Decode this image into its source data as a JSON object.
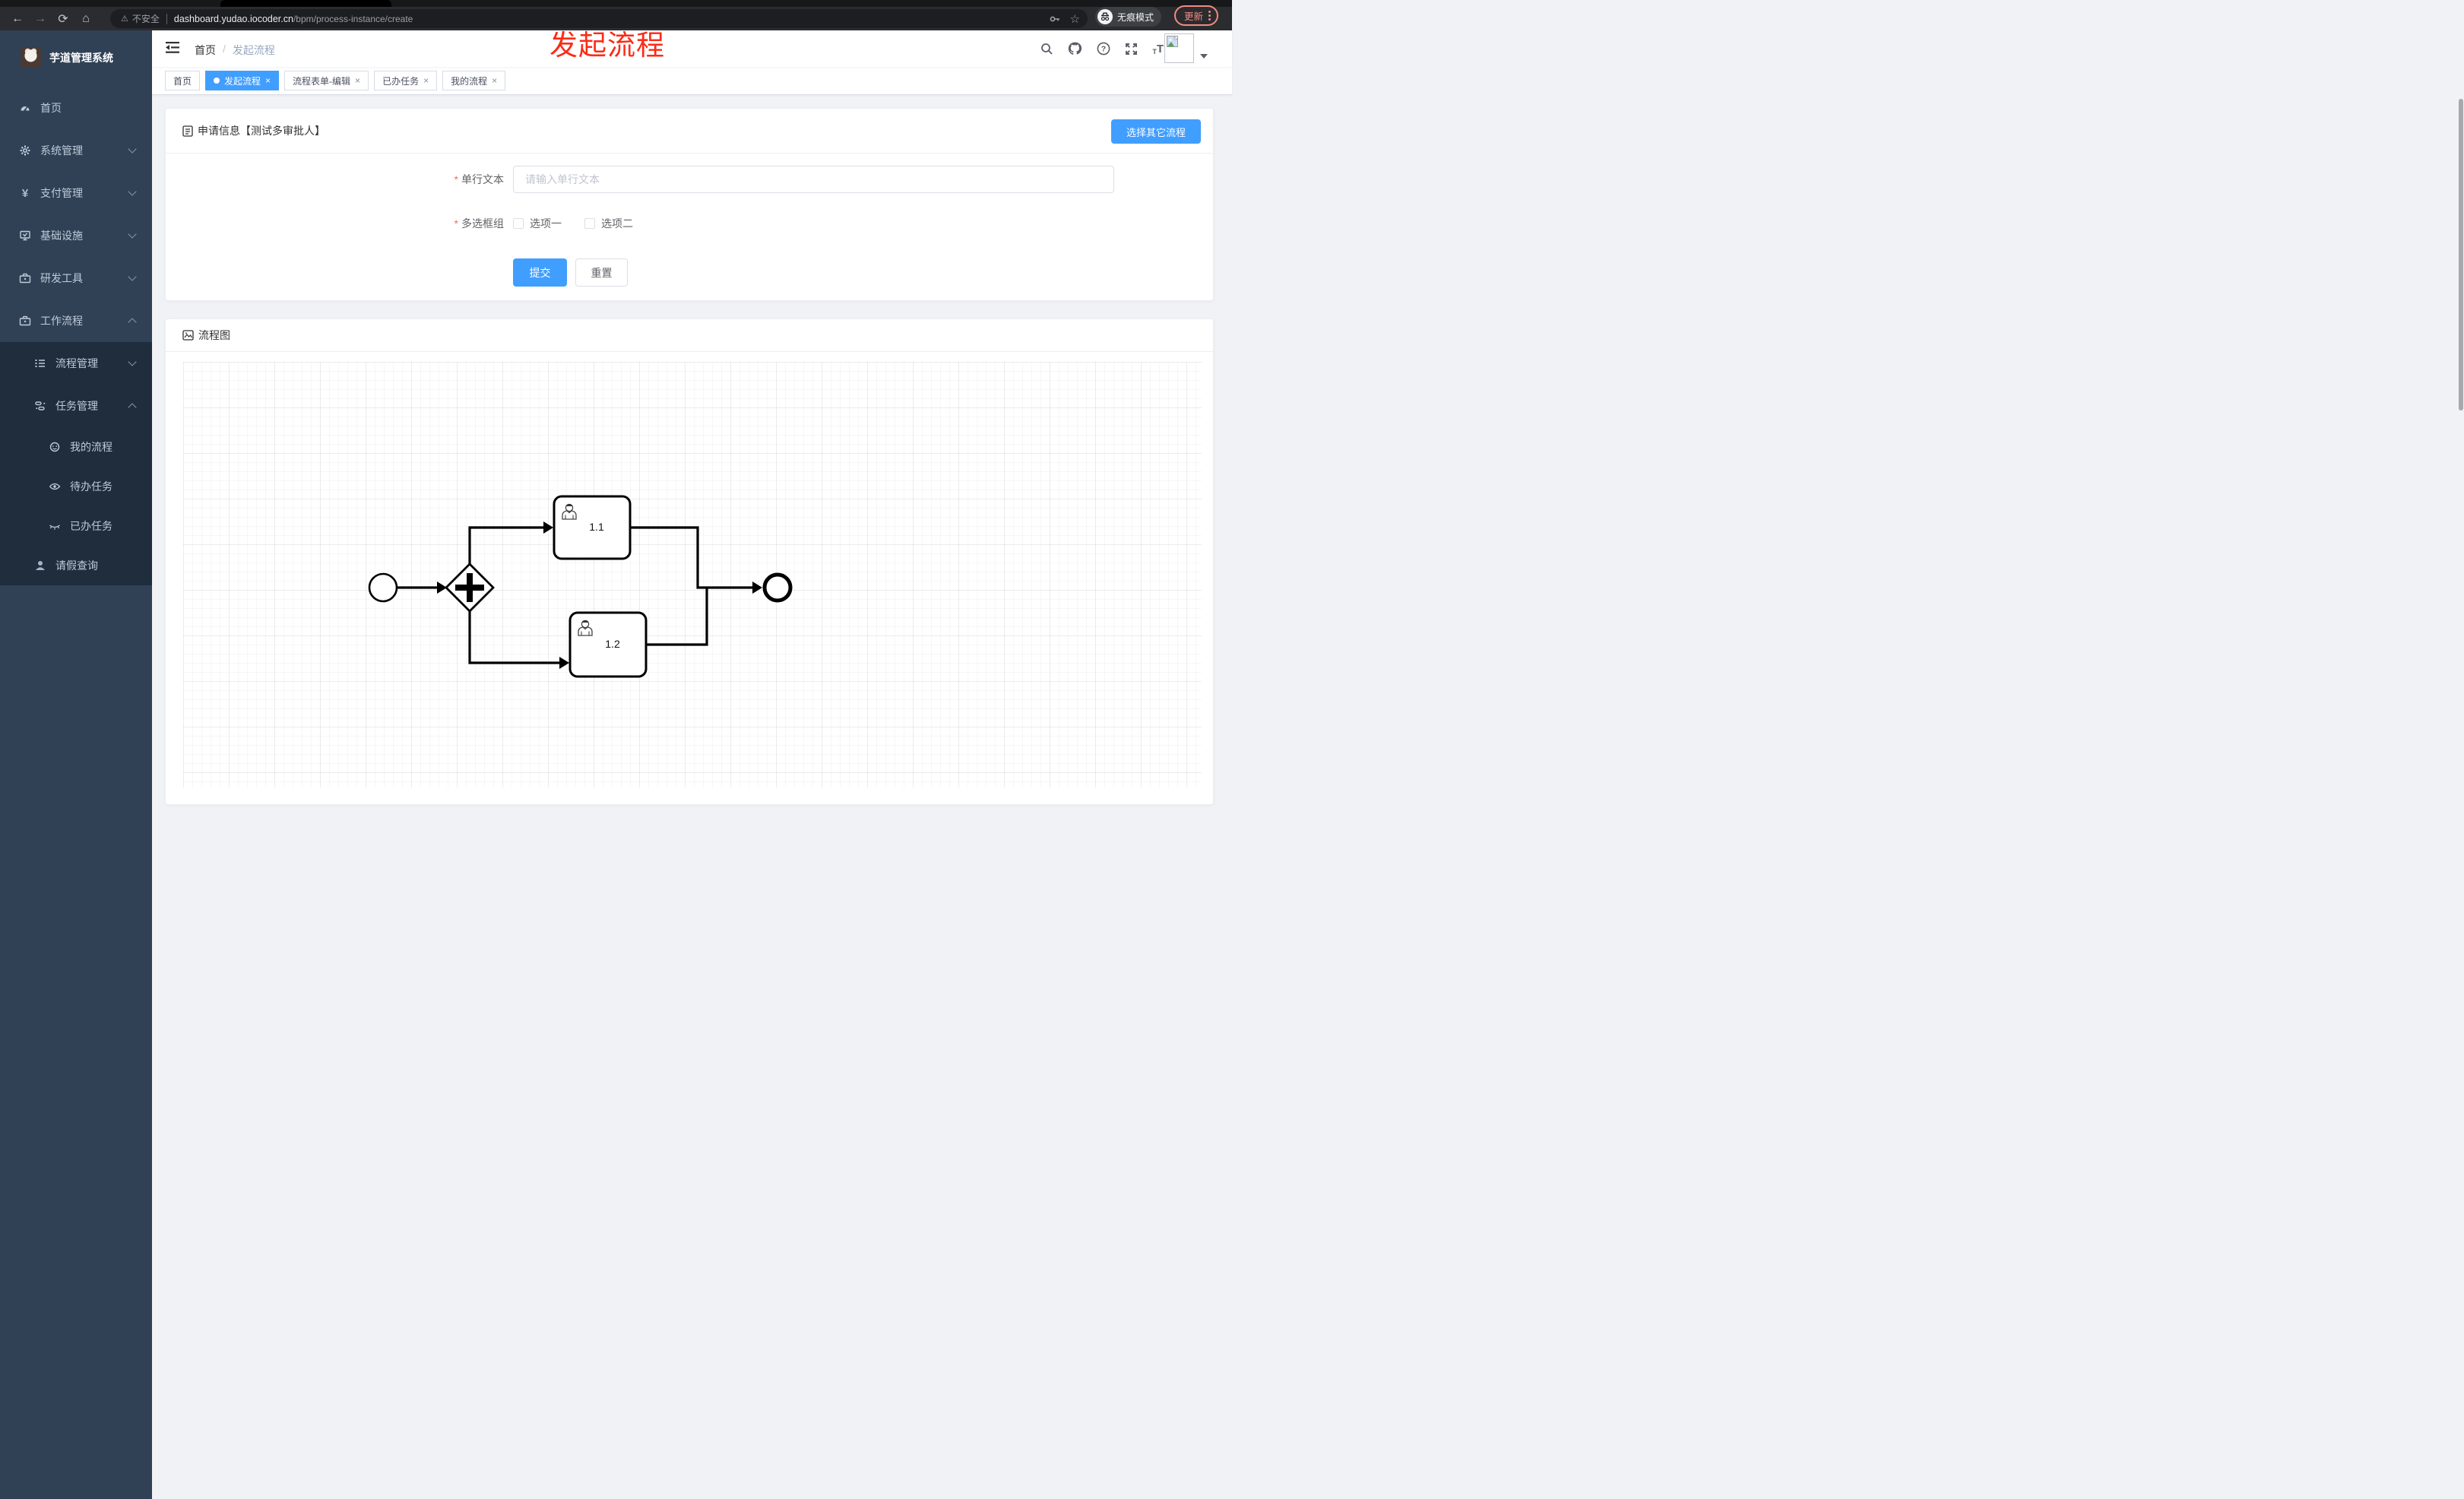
{
  "browser": {
    "security_label": "不安全",
    "url_domain": "dashboard.yudao.iocoder.cn",
    "url_path": "/bpm/process-instance/create",
    "incognito_label": "无痕模式",
    "update_label": "更新",
    "back_glyph": "←",
    "forward_glyph": "→",
    "reload_glyph": "⟳",
    "home_glyph": "⌂",
    "warning_glyph": "⚠",
    "star_glyph": "☆"
  },
  "annotation": {
    "text": "发起流程",
    "color": "#fb2b17"
  },
  "app": {
    "title": "芋道管理系统"
  },
  "breadcrumb": {
    "root": "首页",
    "separator": "/",
    "current": "发起流程"
  },
  "sidebar": {
    "items": [
      {
        "label": "首页",
        "icon": "dashboard-icon"
      },
      {
        "label": "系统管理",
        "icon": "gear-icon"
      },
      {
        "label": "支付管理",
        "icon": "yen-icon",
        "glyph": "¥"
      },
      {
        "label": "基础设施",
        "icon": "monitor-icon"
      },
      {
        "label": "研发工具",
        "icon": "toolbox-icon"
      },
      {
        "label": "工作流程",
        "icon": "briefcase-icon"
      }
    ],
    "submenu": [
      {
        "label": "流程管理",
        "icon": "process-list-icon"
      },
      {
        "label": "任务管理",
        "icon": "task-tree-icon"
      },
      {
        "label": "我的流程",
        "icon": "my-process-icon"
      },
      {
        "label": "待办任务",
        "icon": "eye-icon"
      },
      {
        "label": "已办任务",
        "icon": "eye-off-icon"
      },
      {
        "label": "请假查询",
        "icon": "user-icon"
      }
    ]
  },
  "tabs": [
    {
      "label": "首页",
      "active": false,
      "closable": false
    },
    {
      "label": "发起流程",
      "active": true,
      "closable": true
    },
    {
      "label": "流程表单-编辑",
      "active": false,
      "closable": true
    },
    {
      "label": "已办任务",
      "active": false,
      "closable": true
    },
    {
      "label": "我的流程",
      "active": false,
      "closable": true
    }
  ],
  "ui": {
    "close_glyph": "×"
  },
  "form_card": {
    "title": "申请信息【测试多审批人】",
    "choose_other_label": "选择其它流程",
    "field_text": {
      "label": "单行文本",
      "required": true,
      "placeholder": "请输入单行文本",
      "value": ""
    },
    "field_checkbox": {
      "label": "多选框组",
      "required": true,
      "options": [
        "选项一",
        "选项二"
      ],
      "checked": [
        false,
        false
      ]
    },
    "submit_label": "提交",
    "reset_label": "重置"
  },
  "diagram_card": {
    "title": "流程图",
    "type": "bpmn-process",
    "elements": [
      "start-event",
      "parallel-gateway",
      "user-task",
      "user-task",
      "end-event"
    ],
    "task1_label": "1.1",
    "task2_label": "1.2"
  },
  "colors": {
    "primary": "#409EFF",
    "required_red": "#F56C6C",
    "annotation_red": "#FB2B17",
    "sidebar_bg": "#304156",
    "submenu_bg": "#1F2D3D",
    "sidebar_text": "#BFCBD9",
    "tag_border": "#D8DCE5"
  }
}
